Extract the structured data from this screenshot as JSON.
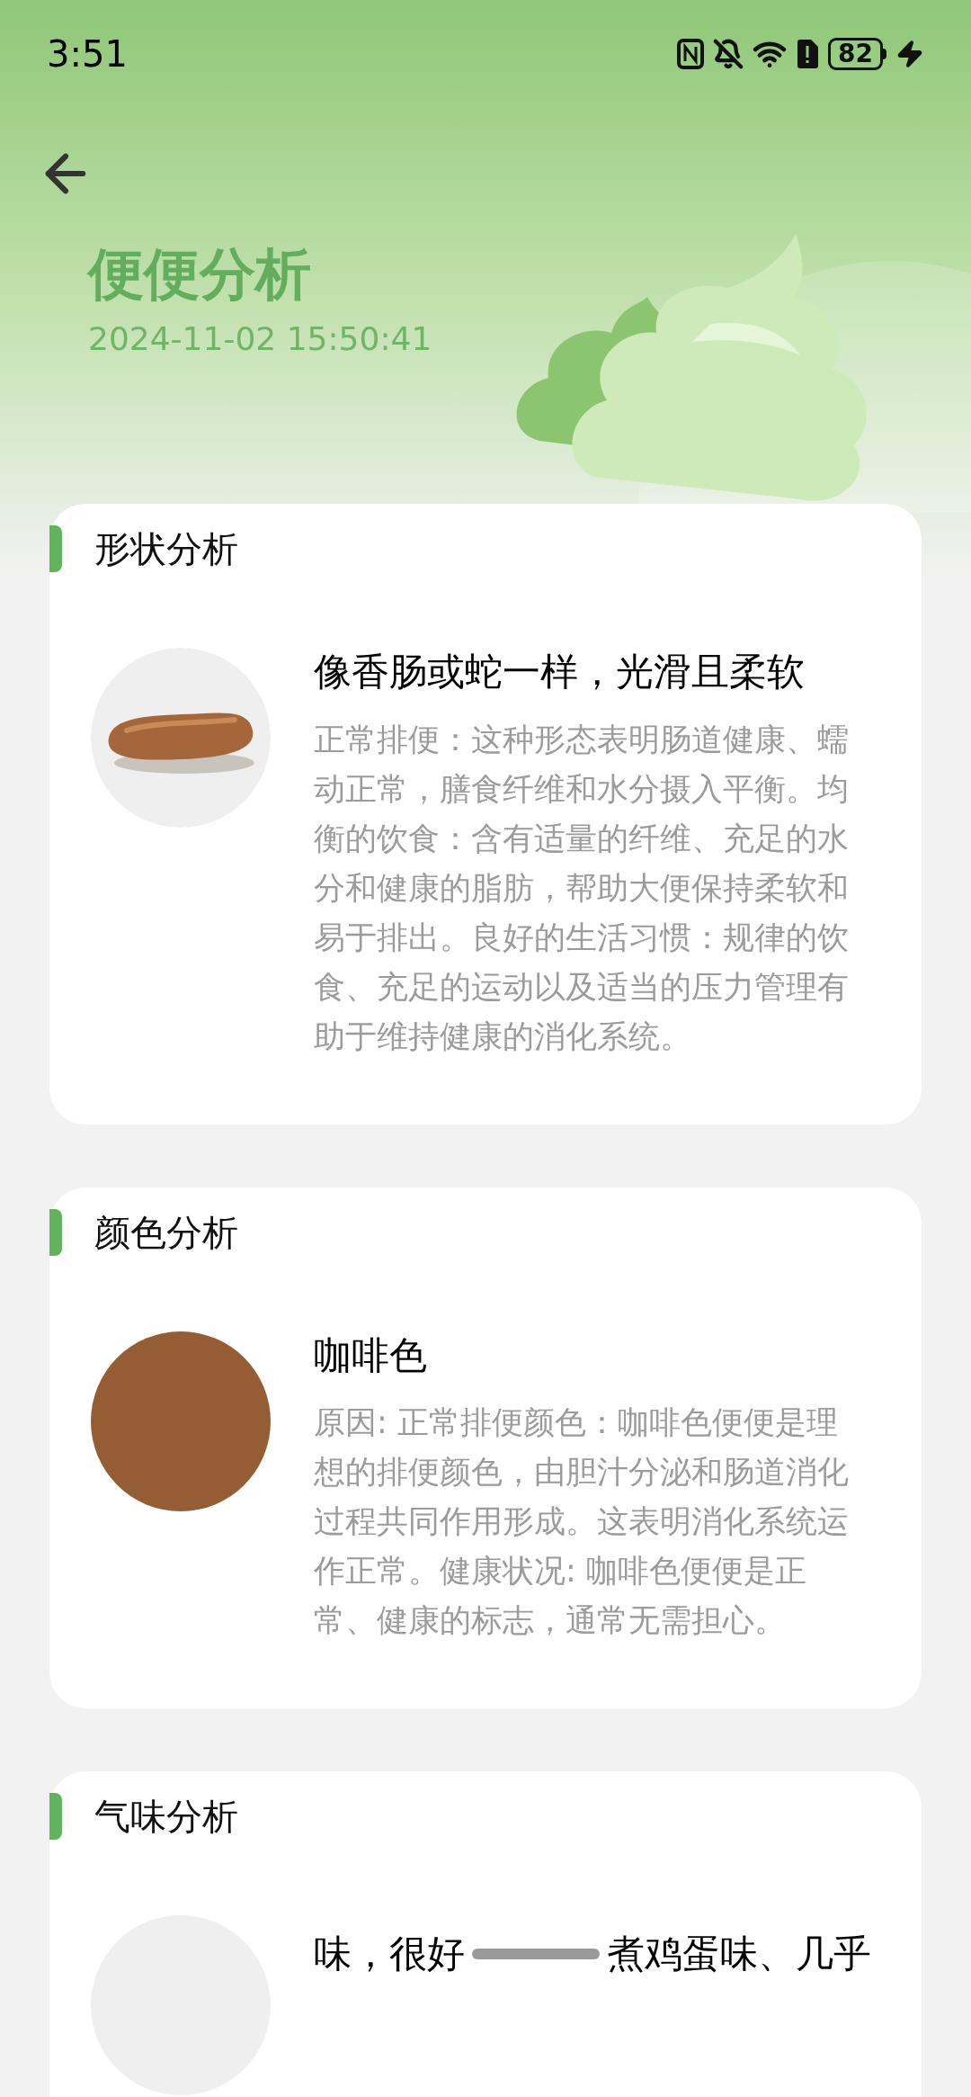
{
  "status_bar": {
    "time": "3:51",
    "battery": "82"
  },
  "header": {
    "title": "便便分析",
    "datetime": "2024-11-02 15:50:41"
  },
  "sections": [
    {
      "kind": "shape",
      "title": "形状分析",
      "heading": "像香肠或蛇一样，光滑且柔软",
      "body": "正常排便：这种形态表明肠道健康、蠕动正常，膳食纤维和水分摄入平衡。均衡的饮食：含有适量的纤维、充足的水分和健康的脂肪，帮助大便保持柔软和易于排出。良好的生活习惯：规律的饮食、充足的运动以及适当的压力管理有助于维持健康的消化系统。"
    },
    {
      "kind": "color",
      "title": "颜色分析",
      "color": "#955d33",
      "heading": "咖啡色",
      "body": "原因: 正常排便颜色：咖啡色便便是理想的排便颜色，由胆汁分泌和肠道消化过程共同作用形成。这表明消化系统运作正常。健康状况: 咖啡色便便是正常、健康的标志，通常无需担心。"
    },
    {
      "kind": "smell",
      "title": "气味分析",
      "fragments": [
        "味，很好",
        "煮鸡蛋味、几乎"
      ]
    }
  ]
}
